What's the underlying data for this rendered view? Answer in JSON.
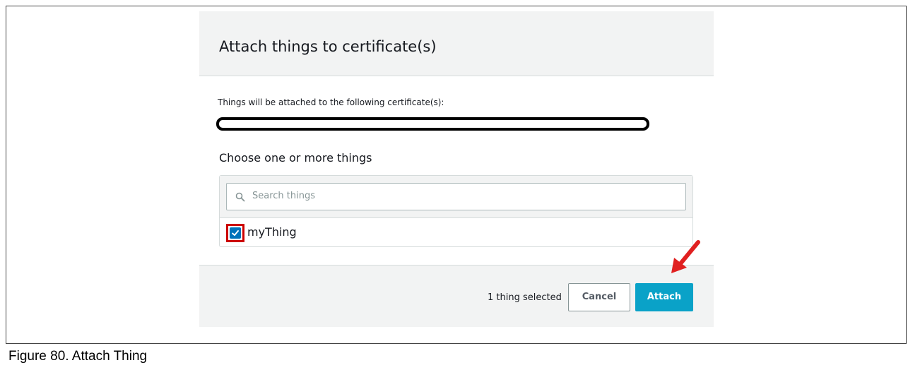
{
  "dialog": {
    "title": "Attach things to certificate(s)",
    "intro_text": "Things will be attached to the following certificate(s):",
    "certificate_value": "",
    "choose_label": "Choose one or more things",
    "search": {
      "placeholder": "Search things"
    },
    "things": [
      {
        "label": "myThing",
        "checked": true
      }
    ],
    "footer": {
      "selected_count": "1 thing selected",
      "cancel_label": "Cancel",
      "attach_label": "Attach"
    }
  },
  "caption": "Figure 80.  Attach Thing",
  "colors": {
    "primary_button": "#0aa2c8",
    "checkbox": "#0073bb",
    "highlight": "#cc0000",
    "arrow": "#e02020"
  }
}
